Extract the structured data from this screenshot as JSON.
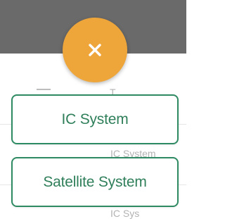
{
  "colors": {
    "header": "#6a6a6a",
    "fab": "#eea63b",
    "button_border": "#2e8a62",
    "button_text": "#2f7f5a"
  },
  "fab": {
    "icon": "close-icon"
  },
  "menu": {
    "items": [
      {
        "label": "IC System"
      },
      {
        "label": "Satellite System"
      }
    ]
  },
  "background": {
    "fragments": [
      "T",
      "IC System",
      "IC Sys"
    ]
  }
}
